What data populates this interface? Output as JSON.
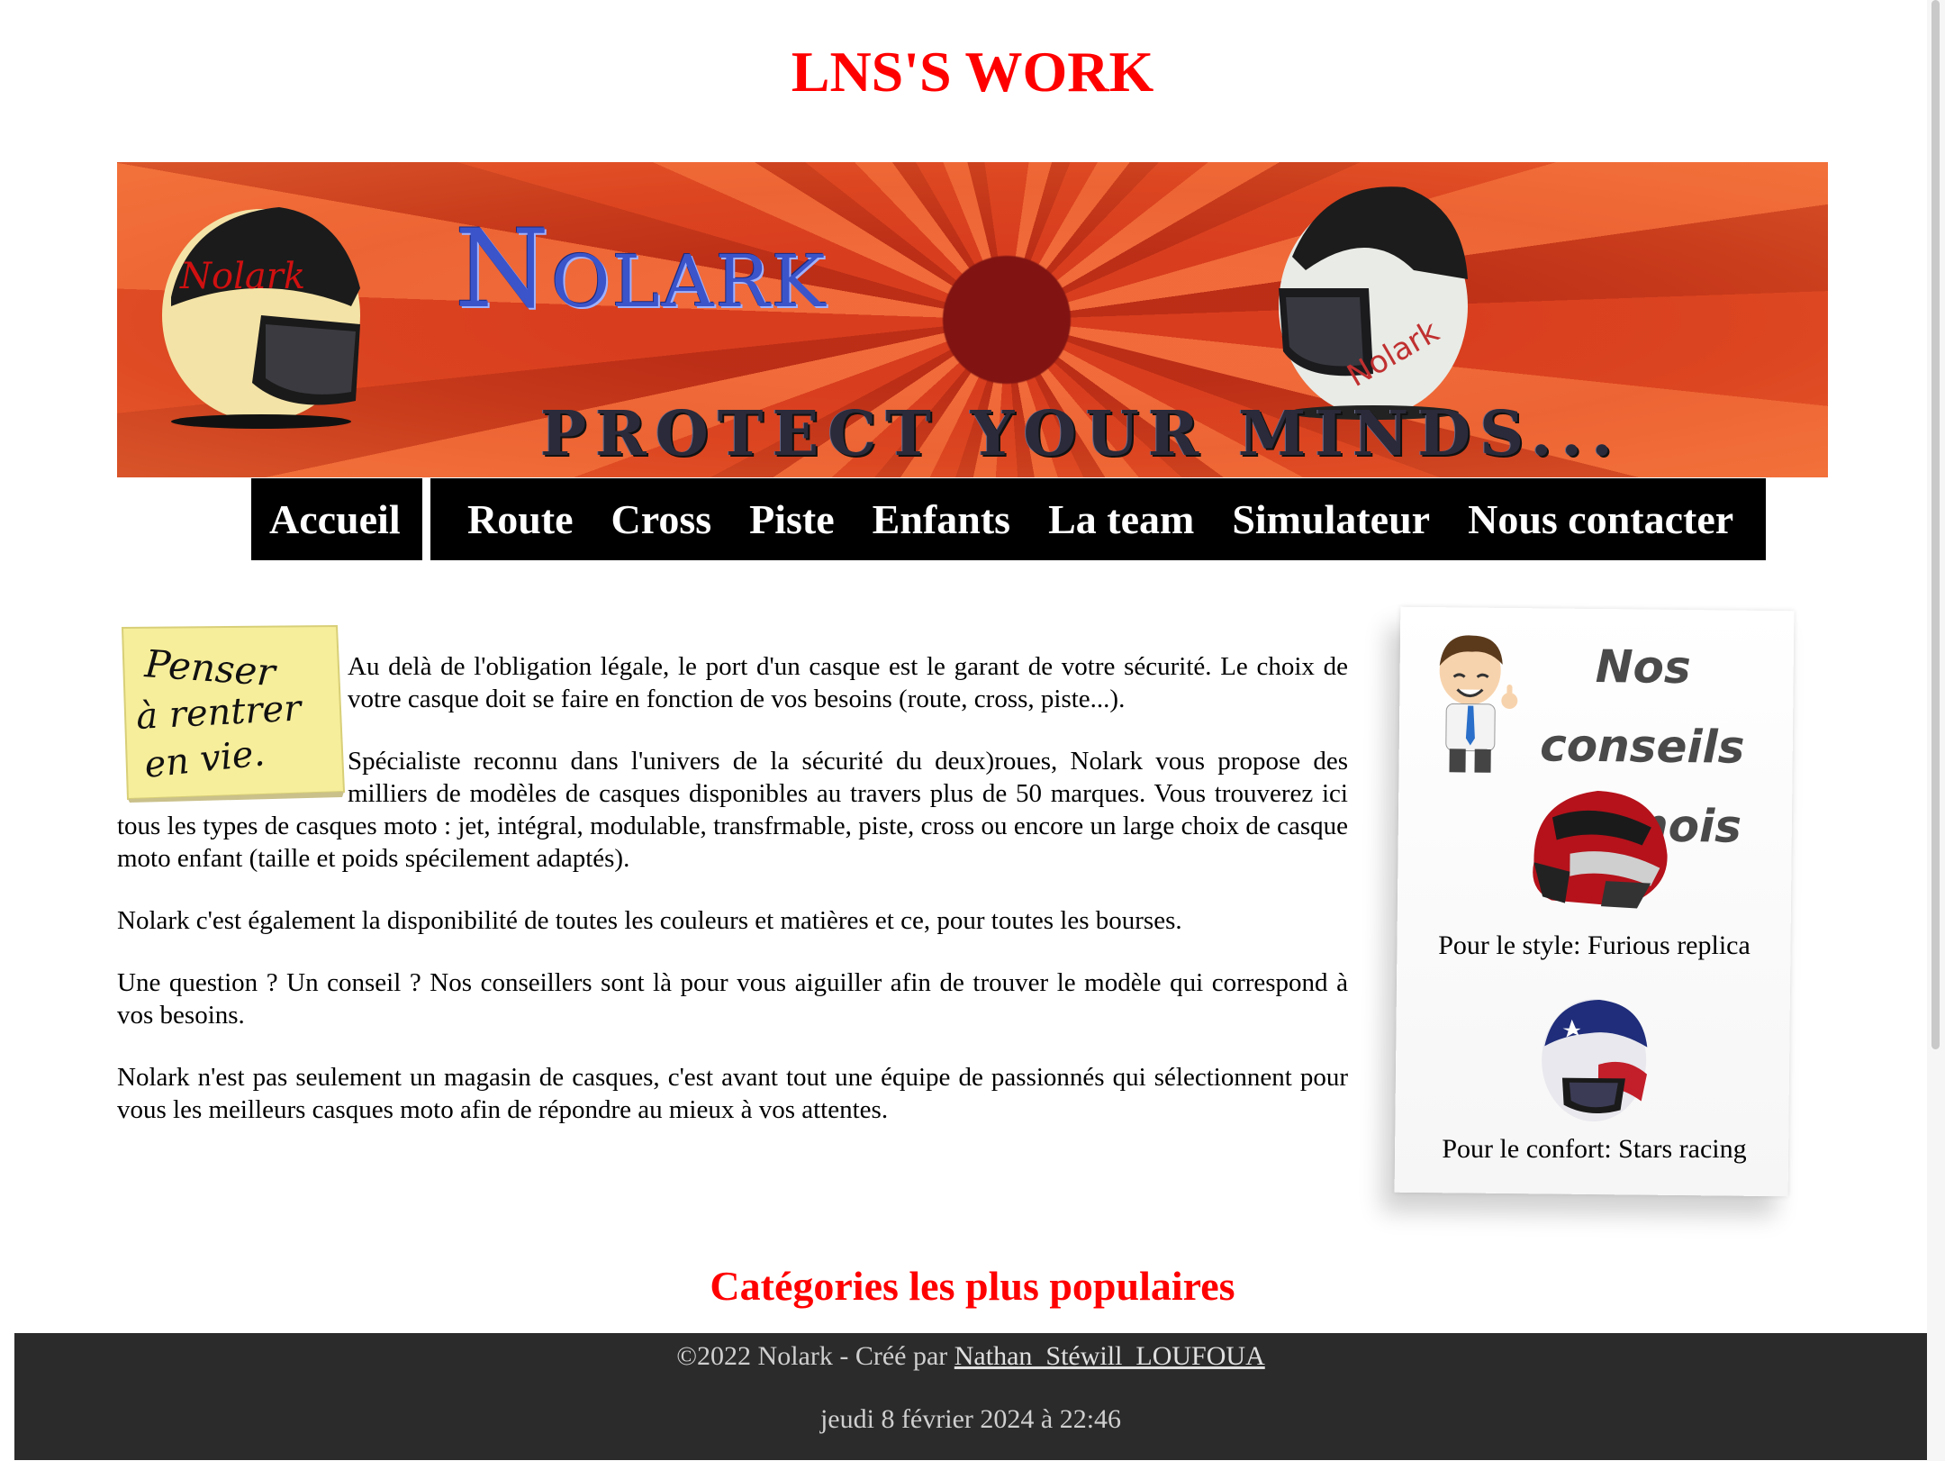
{
  "site": {
    "title": "LNS'S WORK"
  },
  "banner": {
    "brand": "NOLARK",
    "brand_first": "N",
    "brand_rest": "OLARK",
    "slogan": "PROTECT YOUR MINDS...",
    "helmet_text": "Nolark",
    "colors": {
      "background": "#e2552b",
      "logo": "#3b54c9"
    }
  },
  "nav": {
    "home": "Accueil",
    "items": [
      "Route",
      "Cross",
      "Piste",
      "Enfants",
      "La team",
      "Simulateur",
      "Nous contacter"
    ]
  },
  "note": {
    "line1": "Penser",
    "line2": "à rentrer",
    "line3": "en vie."
  },
  "content": {
    "paragraphs": [
      "Au delà de l'obligation légale, le port d'un casque est le garant de votre sécurité. Le choix de votre casque doit se faire en fonction de vos besoins (route, cross, piste...).",
      "Spécialiste reconnu dans l'univers de la sécurité du deux)roues, Nolark vous propose des milliers de modèles de casques disponibles au travers plus de 50 marques. Vous trouverez ici tous les types de casques moto : jet, intégral, modulable, transfrmable, piste, cross ou encore un large choix de casque moto enfant (taille et poids spécilement adaptés).",
      "Nolark c'est également la disponibilité de toutes les couleurs et matières et ce, pour toutes les bourses.",
      "Une question ? Un conseil ? Nos conseillers sont là pour vous aiguiller afin de trouver le modèle qui correspond à vos besoins.",
      "Nolark n'est pas seulement un magasin de casques, c'est avant tout une équipe de passionnés qui sélectionnent pour vous les meilleurs casques moto afin de répondre au mieux à vos attentes."
    ]
  },
  "sidebar": {
    "title_line1": "Nos conseils",
    "title_line2": "du mois",
    "tips": [
      {
        "label": "Pour le style: Furious replica"
      },
      {
        "label": "Pour le confort: Stars racing"
      }
    ]
  },
  "popular": {
    "title": "Catégories les plus populaires"
  },
  "footer": {
    "copyright": "©2022 Nolark - Créé par",
    "author": "Nathan_Stéwill_LOUFOUA",
    "date": "jeudi 8 février 2024 à 22:46",
    "colors": {
      "background": "#2b2b2b",
      "text": "#cfcfcf"
    }
  },
  "colors": {
    "accent": "#ff0000",
    "nav_bg": "#000000"
  }
}
